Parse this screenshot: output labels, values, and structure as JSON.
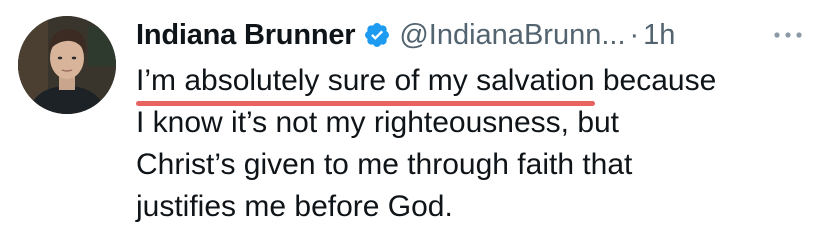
{
  "tweet": {
    "author": {
      "display_name": "Indiana Brunner",
      "handle": "@IndianaBrunn...",
      "verified_icon": "verified-badge-icon",
      "avatar": "profile-photo"
    },
    "separator": "·",
    "time": "1h",
    "more_icon": "more-horizontal-icon",
    "text": {
      "line1_highlight": "I’m absolutely sure of my salvation",
      "line1_rest": " because",
      "line2": "I know it’s not my righteousness, but",
      "line3": "Christ’s given to me through faith that",
      "line4": "justifies me before God."
    }
  },
  "colors": {
    "text": "#0f1419",
    "secondary": "#536471",
    "verified": "#1d9bf0",
    "highlight_underline": "#e8625f"
  }
}
